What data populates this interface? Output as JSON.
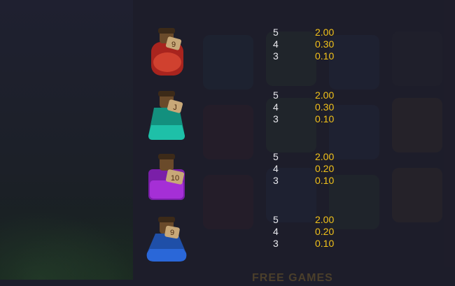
{
  "paytable": [
    {
      "symbol": "red-potion-icon",
      "color": "#c0342a",
      "badge": "9",
      "pays": [
        {
          "count": "5",
          "value": "2.00"
        },
        {
          "count": "4",
          "value": "0.30"
        },
        {
          "count": "3",
          "value": "0.10"
        }
      ]
    },
    {
      "symbol": "teal-potion-icon",
      "color": "#1ec0a8",
      "badge": "J",
      "pays": [
        {
          "count": "5",
          "value": "2.00"
        },
        {
          "count": "4",
          "value": "0.30"
        },
        {
          "count": "3",
          "value": "0.10"
        }
      ]
    },
    {
      "symbol": "purple-potion-icon",
      "color": "#a52fd6",
      "badge": "10",
      "pays": [
        {
          "count": "5",
          "value": "2.00"
        },
        {
          "count": "4",
          "value": "0.20"
        },
        {
          "count": "3",
          "value": "0.10"
        }
      ]
    },
    {
      "symbol": "blue-potion-icon",
      "color": "#2a67d8",
      "badge": "9",
      "pays": [
        {
          "count": "5",
          "value": "2.00"
        },
        {
          "count": "4",
          "value": "0.20"
        },
        {
          "count": "3",
          "value": "0.10"
        }
      ]
    }
  ],
  "section": {
    "next_title": "FREE GAMES"
  },
  "colors": {
    "pay_value": "#f2c21a",
    "pay_count": "#e9e9ee"
  }
}
